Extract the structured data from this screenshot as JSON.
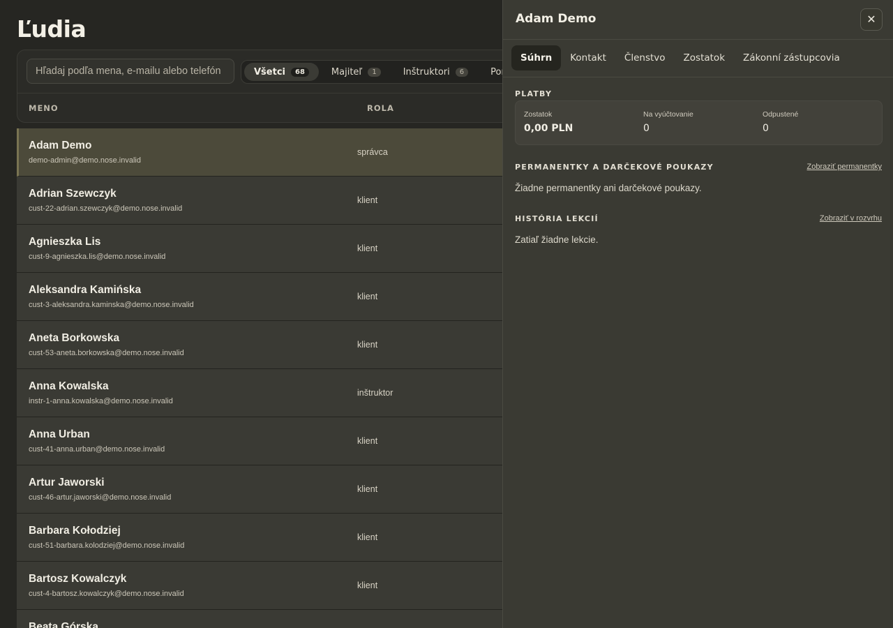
{
  "page": {
    "title": "Ľudia"
  },
  "search": {
    "placeholder": "Hľadaj podľa mena, e-mailu alebo telefón"
  },
  "filters": [
    {
      "label": "Všetci",
      "count": "68",
      "active": true
    },
    {
      "label": "Majiteľ",
      "count": "1",
      "active": false
    },
    {
      "label": "Inštruktori",
      "count": "6",
      "active": false
    },
    {
      "label": "Por",
      "count": "",
      "active": false
    }
  ],
  "columns": {
    "name": "MENO",
    "role": "ROLA"
  },
  "rows": [
    {
      "name": "Adam Demo",
      "email": "demo-admin@demo.nose.invalid",
      "role": "správca",
      "selected": true
    },
    {
      "name": "Adrian Szewczyk",
      "email": "cust-22-adrian.szewczyk@demo.nose.invalid",
      "role": "klient"
    },
    {
      "name": "Agnieszka Lis",
      "email": "cust-9-agnieszka.lis@demo.nose.invalid",
      "role": "klient"
    },
    {
      "name": "Aleksandra Kamińska",
      "email": "cust-3-aleksandra.kaminska@demo.nose.invalid",
      "role": "klient"
    },
    {
      "name": "Aneta Borkowska",
      "email": "cust-53-aneta.borkowska@demo.nose.invalid",
      "role": "klient"
    },
    {
      "name": "Anna Kowalska",
      "email": "instr-1-anna.kowalska@demo.nose.invalid",
      "role": "inštruktor"
    },
    {
      "name": "Anna Urban",
      "email": "cust-41-anna.urban@demo.nose.invalid",
      "role": "klient"
    },
    {
      "name": "Artur Jaworski",
      "email": "cust-46-artur.jaworski@demo.nose.invalid",
      "role": "klient"
    },
    {
      "name": "Barbara Kołodziej",
      "email": "cust-51-barbara.kolodziej@demo.nose.invalid",
      "role": "klient"
    },
    {
      "name": "Bartosz Kowalczyk",
      "email": "cust-4-bartosz.kowalczyk@demo.nose.invalid",
      "role": "klient"
    },
    {
      "name": "Beata Górska",
      "email": "",
      "role": ""
    }
  ],
  "panel": {
    "title": "Adam Demo",
    "close_icon": "close-icon",
    "tabs": [
      {
        "label": "Súhrn",
        "active": true
      },
      {
        "label": "Kontakt"
      },
      {
        "label": "Členstvo"
      },
      {
        "label": "Zostatok"
      },
      {
        "label": "Zákonní zástupcovia"
      }
    ],
    "payments": {
      "title": "PLATBY",
      "stats": [
        {
          "label": "Zostatok",
          "value": "0,00 PLN"
        },
        {
          "label": "Na vyúčtovanie",
          "value": "0"
        },
        {
          "label": "Odpustené",
          "value": "0"
        }
      ]
    },
    "passes": {
      "title": "PERMANENTKY A DARČEKOVÉ POUKAZY",
      "link": "Zobraziť permanentky",
      "empty": "Žiadne permanentky ani darčekové poukazy."
    },
    "history": {
      "title": "HISTÓRIA LEKCIÍ",
      "link": "Zobraziť v rozvrhu",
      "empty": "Zatiaľ žiadne lekcie."
    }
  }
}
